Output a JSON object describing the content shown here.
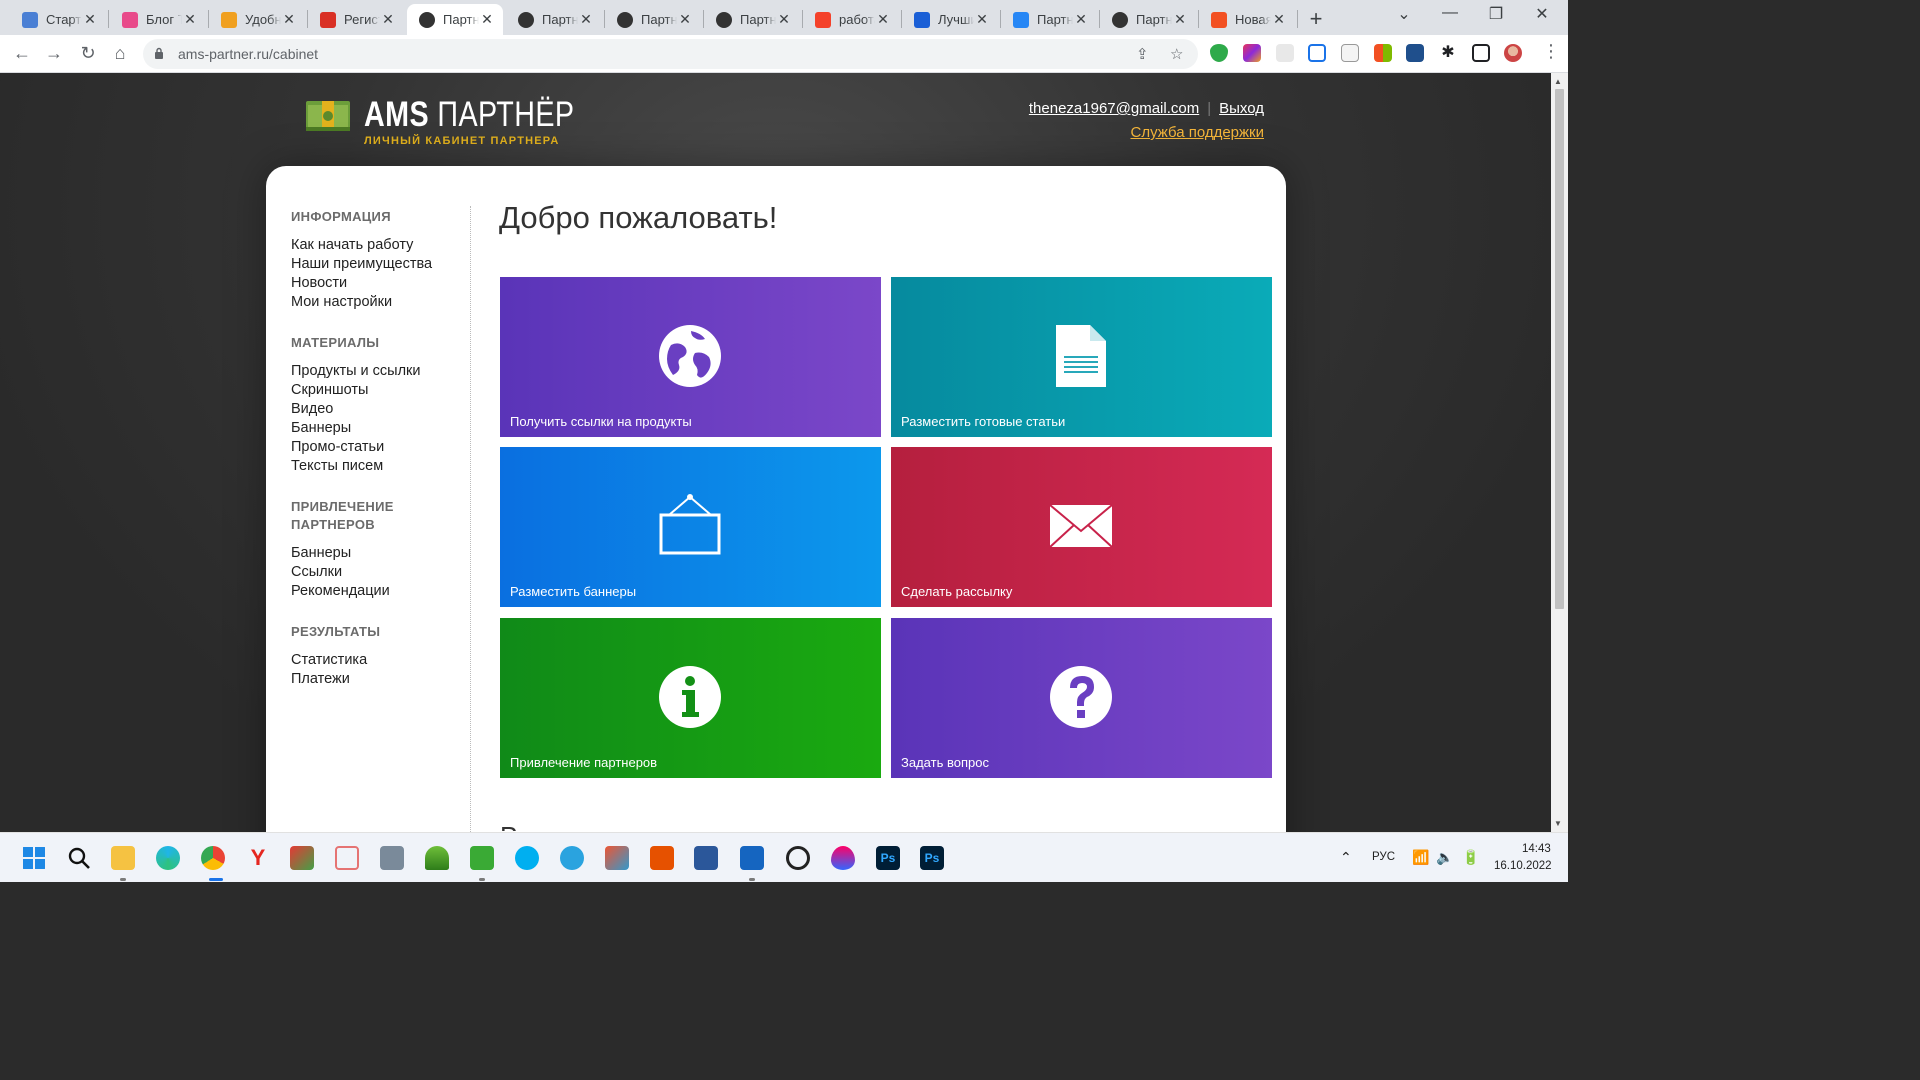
{
  "browser": {
    "tabs": [
      {
        "label": "Стартовая",
        "color": "#4a7fd4",
        "icon": "grid-icon"
      },
      {
        "label": "Блог Тани",
        "color": "#e84a8a",
        "icon": "blog-icon"
      },
      {
        "label": "Удобный",
        "color": "#f0a020",
        "icon": "app-icon"
      },
      {
        "label": "Регистрация",
        "color": "#d93025",
        "icon": "gmail-icon"
      },
      {
        "label": "Партнёр",
        "color": "#333333",
        "icon": "globe-icon"
      },
      {
        "label": "Партнёр",
        "color": "#333333",
        "icon": "globe-icon"
      },
      {
        "label": "Партнёр",
        "color": "#333333",
        "icon": "globe-icon"
      },
      {
        "label": "Партнёр",
        "color": "#333333",
        "icon": "globe-icon"
      },
      {
        "label": "работа",
        "color": "#f4412a",
        "icon": "yandex-icon"
      },
      {
        "label": "Лучшие",
        "color": "#1a5fd6",
        "icon": "circle-icon"
      },
      {
        "label": "Партнёр",
        "color": "#2787f5",
        "icon": "vk-icon"
      },
      {
        "label": "Партнёр",
        "color": "#333333",
        "icon": "globe-icon"
      },
      {
        "label": "Новая",
        "color": "#f25022",
        "icon": "windows-icon"
      }
    ],
    "close_glyph": "✕",
    "new_tab_glyph": "+",
    "url": "ams-partner.ru/cabinet"
  },
  "header": {
    "logo_title_bold": "AMS",
    "logo_title_rest": "ПАРТНЁР",
    "logo_subtitle": "ЛИЧНЫЙ КАБИНЕТ ПАРТНЕРА",
    "email": "theneza1967@gmail.com",
    "logout": "Выход",
    "support": "Служба поддержки"
  },
  "sidebar": {
    "groups": [
      {
        "heading": "ИНФОРМАЦИЯ",
        "items": [
          "Как начать работу",
          "Наши преимущества",
          "Новости",
          "Мои настройки"
        ]
      },
      {
        "heading": "МАТЕРИАЛЫ",
        "items": [
          "Продукты и ссылки",
          "Скриншоты",
          "Видео",
          "Баннеры",
          "Промо-статьи",
          "Тексты писем"
        ]
      },
      {
        "heading": "ПРИВЛЕЧЕНИЕ ПАРТНЕРОВ",
        "items": [
          "Баннеры",
          "Ссылки",
          "Рекомендации"
        ]
      },
      {
        "heading": "РЕЗУЛЬТАТЫ",
        "items": [
          "Статистика",
          "Платежи"
        ]
      }
    ]
  },
  "main": {
    "welcome": "Добро пожаловать!",
    "next_heading_fragment": "Р",
    "tiles": [
      {
        "label": "Получить ссылки на продукты",
        "icon": "globe-icon",
        "color": "#5a34b8"
      },
      {
        "label": "Разместить готовые статьи",
        "icon": "document-icon",
        "color": "#068a9e"
      },
      {
        "label": "Разместить баннеры",
        "icon": "banner-icon",
        "color": "#0a6fe0"
      },
      {
        "label": "Сделать рассылку",
        "icon": "envelope-icon",
        "color": "#b51f3e"
      },
      {
        "label": "Привлечение партнеров",
        "icon": "info-icon",
        "color": "#108a18"
      },
      {
        "label": "Задать вопрос",
        "icon": "question-icon",
        "color": "#5a34b8"
      }
    ]
  },
  "taskbar": {
    "language": "РУС",
    "time": "14:43",
    "date": "16.10.2022"
  }
}
